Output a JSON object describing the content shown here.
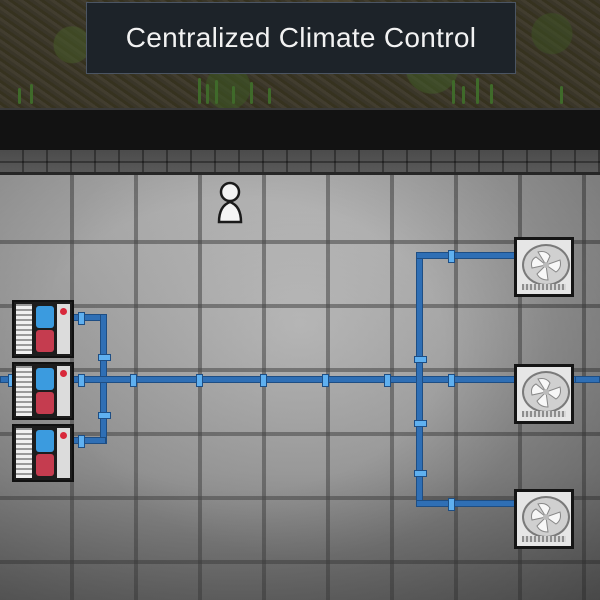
{
  "banner": {
    "title": "Centralized Climate Control"
  },
  "colors": {
    "pipe": "#2f6fb5",
    "pipe_joint": "#5fb0f0",
    "cooler_cold": "#3b9bdf",
    "cooler_hot": "#c53c4f",
    "led": "#d8283b"
  },
  "icons": {
    "pawn": "pawn-icon",
    "fan": "fan-icon"
  }
}
